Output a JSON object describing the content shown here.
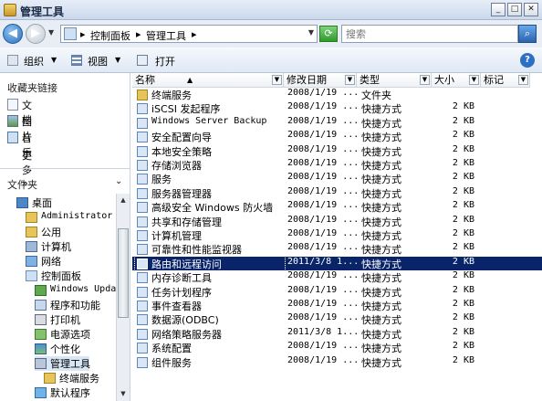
{
  "window": {
    "title": "管理工具",
    "minimize_glyph": "_",
    "maximize_glyph": "□",
    "close_glyph": "✕"
  },
  "address": {
    "crumbs": [
      "控制面板",
      "管理工具"
    ],
    "separator": "▸",
    "back_glyph": "◀",
    "forward_glyph": "▶",
    "search_placeholder": "搜索"
  },
  "toolbar": {
    "organize": "组织",
    "views": "视图",
    "open": "打开",
    "help": "?"
  },
  "favorites": {
    "header": "收藏夹链接",
    "items": [
      {
        "label": "文档",
        "icon": "documents-icon"
      },
      {
        "label": "图片",
        "icon": "pictures-icon"
      },
      {
        "label": "音乐",
        "icon": "music-icon"
      },
      {
        "label": "更多  »",
        "icon": ""
      }
    ]
  },
  "folders": {
    "header": "文件夹",
    "tree": [
      {
        "label": "桌面",
        "indent": 1,
        "icon": "desktop-icon"
      },
      {
        "label": "Administrator",
        "indent": 2,
        "icon": "user-folder-icon",
        "mono": true
      },
      {
        "label": "公用",
        "indent": 2,
        "icon": "folder-icon"
      },
      {
        "label": "计算机",
        "indent": 2,
        "icon": "computer-icon"
      },
      {
        "label": "网络",
        "indent": 2,
        "icon": "network-icon"
      },
      {
        "label": "控制面板",
        "indent": 2,
        "icon": "control-panel-icon"
      },
      {
        "label": "Windows Updat",
        "indent": 3,
        "icon": "windows-update-icon",
        "mono": true
      },
      {
        "label": "程序和功能",
        "indent": 3,
        "icon": "programs-icon"
      },
      {
        "label": "打印机",
        "indent": 3,
        "icon": "printer-icon"
      },
      {
        "label": "电源选项",
        "indent": 3,
        "icon": "power-icon"
      },
      {
        "label": "个性化",
        "indent": 3,
        "icon": "personalize-icon"
      },
      {
        "label": "管理工具",
        "indent": 3,
        "icon": "admin-tools-icon",
        "selected": true
      },
      {
        "label": "终端服务",
        "indent": 4,
        "icon": "folder-icon"
      },
      {
        "label": "默认程序",
        "indent": 3,
        "icon": "default-programs-icon"
      }
    ]
  },
  "list": {
    "columns": [
      "名称",
      "修改日期",
      "类型",
      "大小",
      "标记"
    ],
    "rows": [
      {
        "name": "终端服务",
        "date": "2008/1/19 ...",
        "type": "文件夹",
        "size": "",
        "kind": "folder"
      },
      {
        "name": "iSCSI 发起程序",
        "date": "2008/1/19 ...",
        "type": "快捷方式",
        "size": "2 KB",
        "kind": "shortcut"
      },
      {
        "name": "Windows Server Backup",
        "date": "2008/1/19 ...",
        "type": "快捷方式",
        "size": "2 KB",
        "kind": "shortcut",
        "mono": true
      },
      {
        "name": "安全配置向导",
        "date": "2008/1/19 ...",
        "type": "快捷方式",
        "size": "2 KB",
        "kind": "shortcut"
      },
      {
        "name": "本地安全策略",
        "date": "2008/1/19 ...",
        "type": "快捷方式",
        "size": "2 KB",
        "kind": "shortcut"
      },
      {
        "name": "存储浏览器",
        "date": "2008/1/19 ...",
        "type": "快捷方式",
        "size": "2 KB",
        "kind": "shortcut"
      },
      {
        "name": "服务",
        "date": "2008/1/19 ...",
        "type": "快捷方式",
        "size": "2 KB",
        "kind": "shortcut"
      },
      {
        "name": "服务器管理器",
        "date": "2008/1/19 ...",
        "type": "快捷方式",
        "size": "2 KB",
        "kind": "shortcut"
      },
      {
        "name": "高级安全 Windows 防火墙",
        "date": "2008/1/19 ...",
        "type": "快捷方式",
        "size": "2 KB",
        "kind": "shortcut"
      },
      {
        "name": "共享和存储管理",
        "date": "2008/1/19 ...",
        "type": "快捷方式",
        "size": "2 KB",
        "kind": "shortcut"
      },
      {
        "name": "计算机管理",
        "date": "2008/1/19 ...",
        "type": "快捷方式",
        "size": "2 KB",
        "kind": "shortcut"
      },
      {
        "name": "可靠性和性能监视器",
        "date": "2008/1/19 ...",
        "type": "快捷方式",
        "size": "2 KB",
        "kind": "shortcut"
      },
      {
        "name": "路由和远程访问",
        "date": "2011/3/8 1...",
        "type": "快捷方式",
        "size": "2 KB",
        "kind": "shortcut",
        "selected": true
      },
      {
        "name": "内存诊断工具",
        "date": "2008/1/19 ...",
        "type": "快捷方式",
        "size": "2 KB",
        "kind": "shortcut"
      },
      {
        "name": "任务计划程序",
        "date": "2008/1/19 ...",
        "type": "快捷方式",
        "size": "2 KB",
        "kind": "shortcut"
      },
      {
        "name": "事件查看器",
        "date": "2008/1/19 ...",
        "type": "快捷方式",
        "size": "2 KB",
        "kind": "shortcut"
      },
      {
        "name": "数据源(ODBC)",
        "date": "2008/1/19 ...",
        "type": "快捷方式",
        "size": "2 KB",
        "kind": "shortcut"
      },
      {
        "name": "网络策略服务器",
        "date": "2011/3/8 1...",
        "type": "快捷方式",
        "size": "2 KB",
        "kind": "shortcut"
      },
      {
        "name": "系统配置",
        "date": "2008/1/19 ...",
        "type": "快捷方式",
        "size": "2 KB",
        "kind": "shortcut"
      },
      {
        "name": "组件服务",
        "date": "2008/1/19 ...",
        "type": "快捷方式",
        "size": "2 KB",
        "kind": "shortcut"
      }
    ]
  },
  "colors": {
    "selection": "#0a246a",
    "folder": "#e8c55a",
    "shortcut": "#5a86c2"
  }
}
